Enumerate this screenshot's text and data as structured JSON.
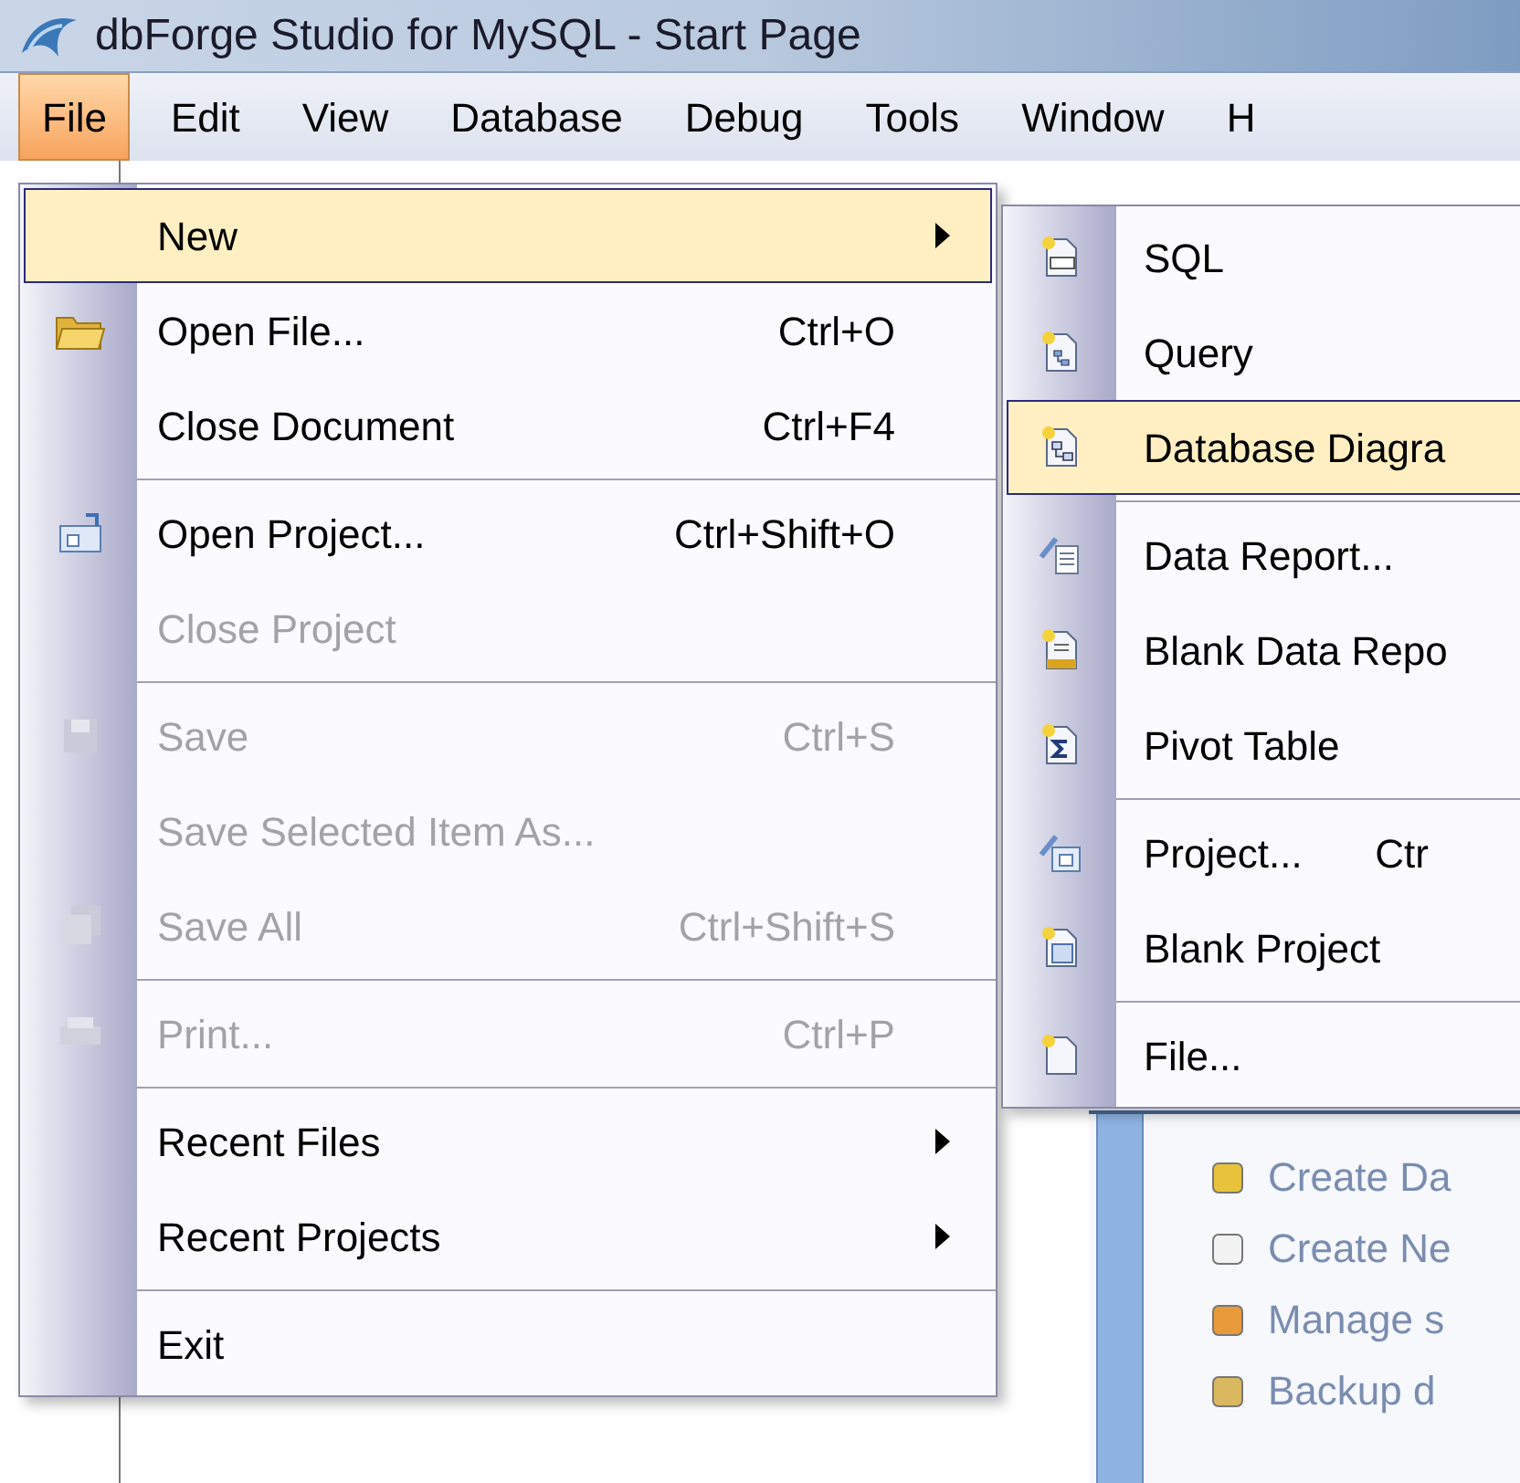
{
  "window": {
    "title": "dbForge Studio for MySQL - Start Page"
  },
  "menu_bar": [
    {
      "label": "File",
      "selected": true
    },
    {
      "label": "Edit",
      "selected": false
    },
    {
      "label": "View",
      "selected": false
    },
    {
      "label": "Database",
      "selected": false
    },
    {
      "label": "Debug",
      "selected": false
    },
    {
      "label": "Tools",
      "selected": false
    },
    {
      "label": "Window",
      "selected": false
    },
    {
      "label": "H",
      "selected": false
    }
  ],
  "file_menu": {
    "groups": [
      [
        {
          "label": "New",
          "submenu": true,
          "disabled": false,
          "selected": true
        },
        {
          "label": "Open File...",
          "shortcut": "Ctrl+O",
          "submenu": false,
          "disabled": false,
          "selected": false
        },
        {
          "label": "Close Document",
          "shortcut": "Ctrl+F4",
          "submenu": false,
          "disabled": false,
          "selected": false
        }
      ],
      [
        {
          "label": "Open Project...",
          "shortcut": "Ctrl+Shift+O",
          "submenu": false,
          "disabled": false,
          "selected": false
        },
        {
          "label": "Close Project",
          "submenu": false,
          "disabled": true,
          "selected": false
        }
      ],
      [
        {
          "label": "Save",
          "shortcut": "Ctrl+S",
          "submenu": false,
          "disabled": true,
          "selected": false
        },
        {
          "label": "Save Selected Item As...",
          "submenu": false,
          "disabled": true,
          "selected": false
        },
        {
          "label": "Save All",
          "shortcut": "Ctrl+Shift+S",
          "submenu": false,
          "disabled": true,
          "selected": false
        }
      ],
      [
        {
          "label": "Print...",
          "shortcut": "Ctrl+P",
          "submenu": false,
          "disabled": true,
          "selected": false
        }
      ],
      [
        {
          "label": "Recent Files",
          "submenu": true,
          "disabled": false,
          "selected": false
        },
        {
          "label": "Recent Projects",
          "submenu": true,
          "disabled": false,
          "selected": false
        }
      ],
      [
        {
          "label": "Exit",
          "submenu": false,
          "disabled": false,
          "selected": false
        }
      ]
    ]
  },
  "new_submenu": {
    "groups": [
      [
        {
          "label": "SQL",
          "selected": false
        },
        {
          "label": "Query",
          "selected": false
        },
        {
          "label": "Database Diagra",
          "selected": true
        }
      ],
      [
        {
          "label": "Data Report...",
          "selected": false
        },
        {
          "label": "Blank Data Repo",
          "selected": false
        },
        {
          "label": "Pivot Table",
          "selected": false
        }
      ],
      [
        {
          "label": "Project...",
          "shortcut": "Ctr",
          "selected": false
        },
        {
          "label": "Blank Project",
          "selected": false
        }
      ],
      [
        {
          "label": "File...",
          "selected": false
        }
      ]
    ]
  },
  "start_page": {
    "links": [
      "Create Da",
      "Create Ne",
      "Manage s",
      "Backup d"
    ]
  }
}
